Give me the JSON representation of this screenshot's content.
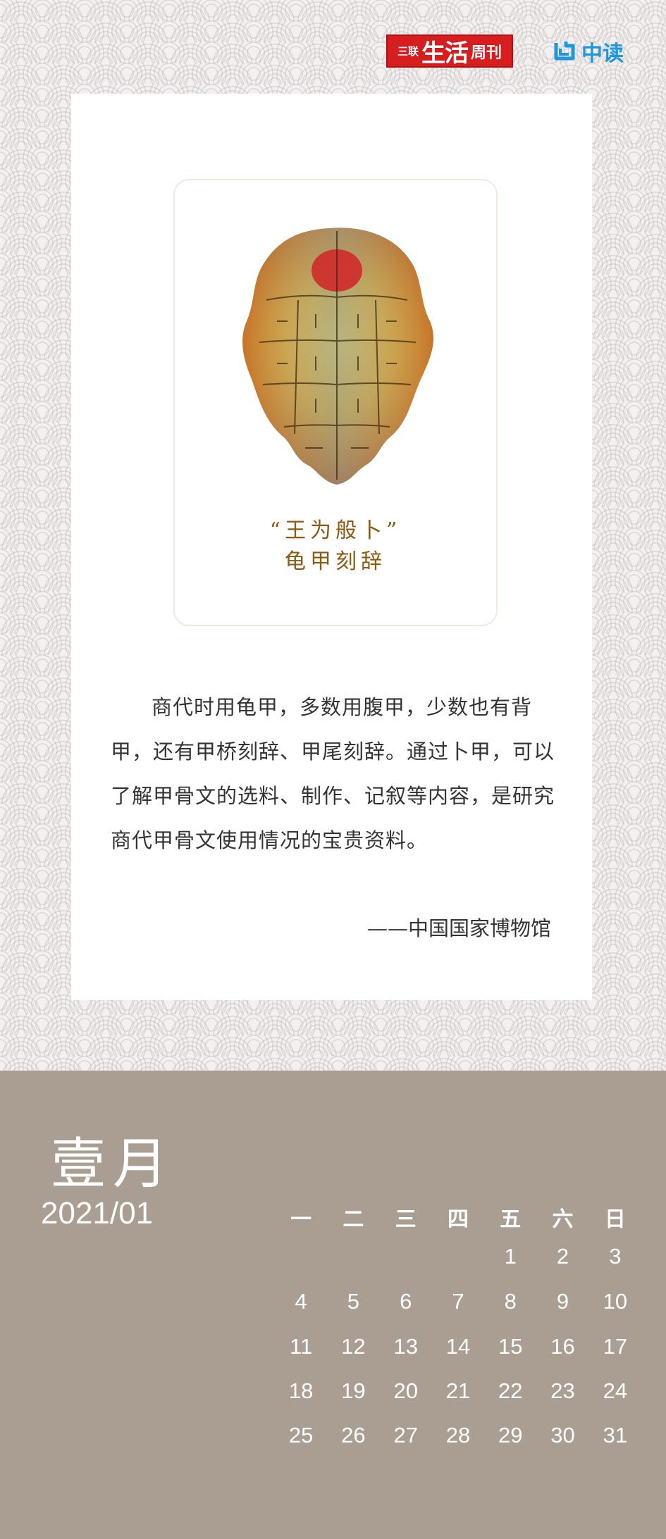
{
  "header": {
    "logo_sanlian": {
      "mark": "三联",
      "main": "生活",
      "suffix": "周刊"
    },
    "logo_zhongdu": {
      "text": "中读"
    }
  },
  "artifact": {
    "caption_line1": "“王为般卜”",
    "caption_line2": "龟甲刻辞"
  },
  "description": "商代时用龟甲，多数用腹甲，少数也有背甲，还有甲桥刻辞、甲尾刻辞。通过卜甲，可以了解甲骨文的选料、制作、记叙等内容，是研究商代甲骨文使用情况的宝贵资料。",
  "source": "——中国国家博物馆",
  "calendar": {
    "month_name": "壹月",
    "year_month": "2021/01",
    "weekdays": [
      "一",
      "二",
      "三",
      "四",
      "五",
      "六",
      "日"
    ],
    "weeks": [
      [
        "",
        "",
        "",
        "",
        "1",
        "2",
        "3"
      ],
      [
        "4",
        "5",
        "6",
        "7",
        "8",
        "9",
        "10"
      ],
      [
        "11",
        "12",
        "13",
        "14",
        "15",
        "16",
        "17"
      ],
      [
        "18",
        "19",
        "20",
        "21",
        "22",
        "23",
        "24"
      ],
      [
        "25",
        "26",
        "27",
        "28",
        "29",
        "30",
        "31"
      ]
    ]
  },
  "colors": {
    "calendar_bg": "#aa9e92",
    "caption": "#8a5a12",
    "sanlian_red": "#d71e1e",
    "zhongdu_blue": "#1e97e0"
  }
}
